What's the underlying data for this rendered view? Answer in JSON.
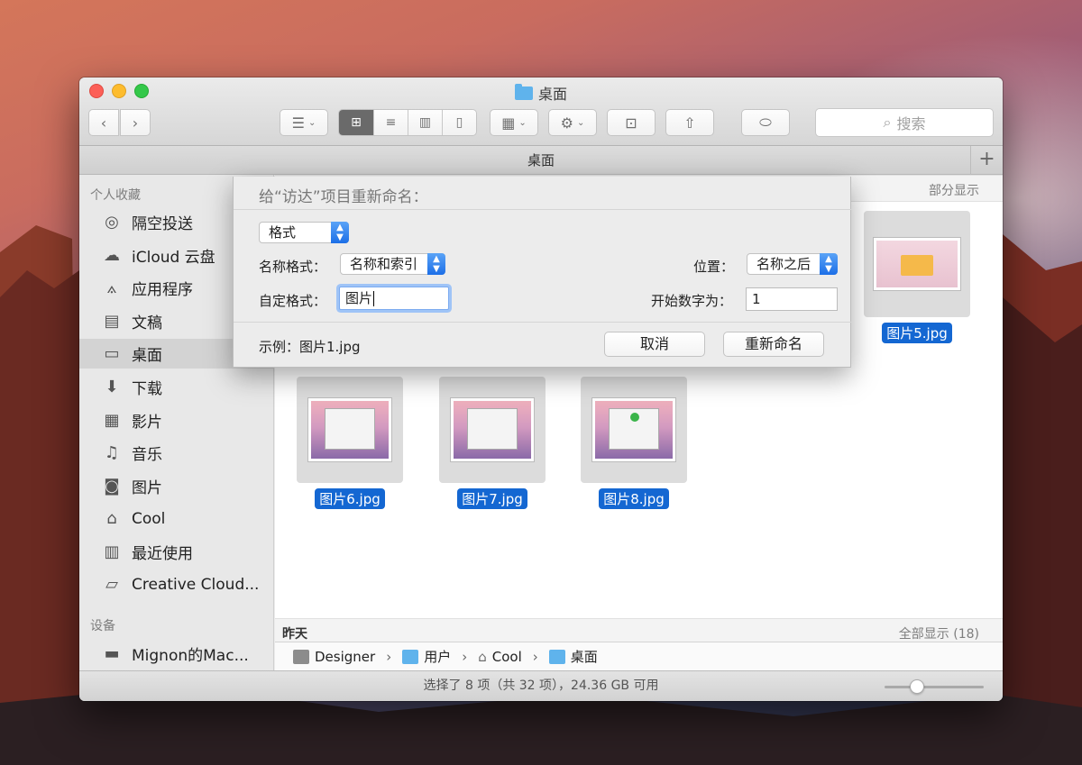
{
  "window": {
    "title": "桌面"
  },
  "toolbar": {
    "back_icon": "chevron-left-icon",
    "forward_icon": "chevron-right-icon",
    "search_placeholder": "搜索"
  },
  "tabbar": {
    "label": "桌面",
    "plus": "+"
  },
  "sidebar": {
    "favorites_header": "个人收藏",
    "items": [
      {
        "label": "隔空投送",
        "icon": "airdrop-icon"
      },
      {
        "label": "iCloud 云盘",
        "icon": "cloud-icon"
      },
      {
        "label": "应用程序",
        "icon": "applications-icon"
      },
      {
        "label": "文稿",
        "icon": "document-icon"
      },
      {
        "label": "桌面",
        "icon": "desktop-icon",
        "selected": true
      },
      {
        "label": "下载",
        "icon": "download-icon"
      },
      {
        "label": "影片",
        "icon": "film-icon"
      },
      {
        "label": "音乐",
        "icon": "music-icon"
      },
      {
        "label": "图片",
        "icon": "camera-icon"
      },
      {
        "label": "Cool",
        "icon": "home-icon"
      },
      {
        "label": "最近使用",
        "icon": "recents-icon"
      },
      {
        "label": "Creative Cloud...",
        "icon": "folder-icon"
      }
    ],
    "devices_header": "设备",
    "device": {
      "label": "Mignon的Mac...",
      "icon": "laptop-icon"
    }
  },
  "main": {
    "section1_more": "部分显示",
    "files": [
      {
        "name": "图片5.jpg"
      },
      {
        "name": "图片6.jpg"
      },
      {
        "name": "图片7.jpg"
      },
      {
        "name": "图片8.jpg"
      }
    ],
    "section2_title": "昨天",
    "section2_more": "全部显示 (18)"
  },
  "pathbar": {
    "items": [
      "Designer",
      "用户",
      "Cool",
      "桌面"
    ],
    "separator": "›"
  },
  "statusbar": {
    "text": "选择了 8 项（共 32 项），24.36 GB 可用",
    "zoom_level": 0.3
  },
  "dialog": {
    "title": "给“访达”项目重新命名：",
    "mode": "格式",
    "name_format_label": "名称格式：",
    "name_format_value": "名称和索引",
    "position_label": "位置：",
    "position_value": "名称之后",
    "custom_format_label": "自定格式：",
    "custom_format_value": "图片",
    "start_number_label": "开始数字为：",
    "start_number_value": "1",
    "example": "示例：图片1.jpg",
    "cancel": "取消",
    "rename": "重新命名"
  }
}
